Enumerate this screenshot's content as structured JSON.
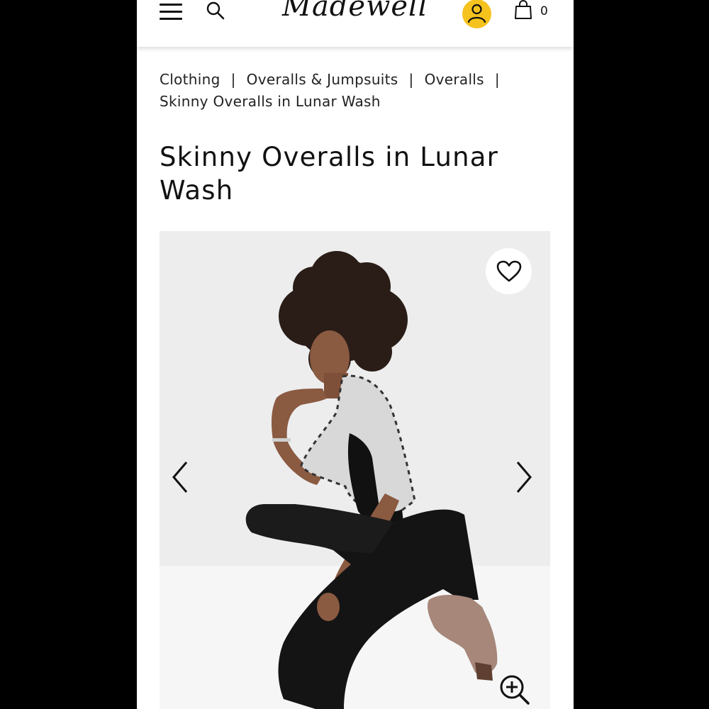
{
  "header": {
    "logo_text": "Madewell",
    "bag_count": "0",
    "icons": {
      "menu": "hamburger-menu-icon",
      "search": "search-icon",
      "account": "user-icon",
      "bag": "shopping-bag-icon"
    },
    "colors": {
      "account_bg": "#f6c21d"
    }
  },
  "breadcrumb": {
    "items": [
      "Clothing",
      "Overalls & Jumpsuits",
      "Overalls",
      "Skinny Overalls in Lunar Wash"
    ],
    "separator": "|"
  },
  "product": {
    "title": "Skinny Overalls in Lunar Wash"
  },
  "gallery": {
    "icons": {
      "favorite": "heart-icon",
      "prev": "chevron-left-icon",
      "next": "chevron-right-icon",
      "zoom": "zoom-in-icon"
    }
  }
}
